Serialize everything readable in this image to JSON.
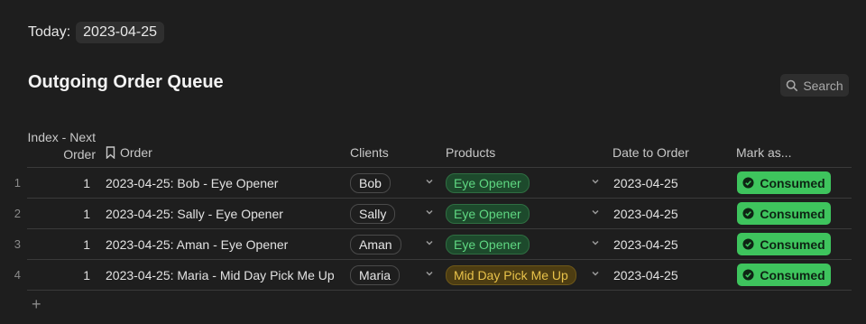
{
  "header": {
    "today_label": "Today:",
    "today_value": "2023-04-25",
    "title": "Outgoing Order Queue",
    "search_label": "Search"
  },
  "table": {
    "columns": {
      "index": "Index - Next Order",
      "order": "Order",
      "clients": "Clients",
      "products": "Products",
      "date": "Date to Order",
      "mark": "Mark as..."
    },
    "rows": [
      {
        "num": "1",
        "index": "1",
        "order": "2023-04-25: Bob - Eye Opener",
        "client": "Bob",
        "product": "Eye Opener",
        "product_color": "#5fd882",
        "date": "2023-04-25",
        "mark": "Consumed"
      },
      {
        "num": "2",
        "index": "1",
        "order": "2023-04-25: Sally - Eye Opener",
        "client": "Sally",
        "product": "Eye Opener",
        "product_color": "#5fd882",
        "date": "2023-04-25",
        "mark": "Consumed"
      },
      {
        "num": "3",
        "index": "1",
        "order": "2023-04-25: Aman - Eye Opener",
        "client": "Aman",
        "product": "Eye Opener",
        "product_color": "#5fd882",
        "date": "2023-04-25",
        "mark": "Consumed"
      },
      {
        "num": "4",
        "index": "1",
        "order": "2023-04-25: Maria - Mid Day Pick Me Up",
        "client": "Maria",
        "product": "Mid Day Pick Me Up",
        "product_color": "#e8c24a",
        "date": "2023-04-25",
        "mark": "Consumed"
      }
    ],
    "add_row_label": "+"
  },
  "colors": {
    "background": "#1e1e1e",
    "consumed_button": "#3ec45d",
    "product_green": "#5fd882",
    "product_yellow": "#e8c24a"
  },
  "icons": {
    "search": "search-icon",
    "order_header": "bookmark-icon",
    "dropdown": "chevron-down-icon",
    "consumed": "check-circle-icon"
  }
}
